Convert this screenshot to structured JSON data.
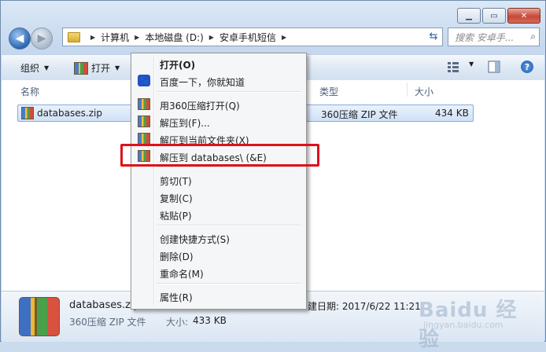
{
  "window": {
    "caption_buttons": [
      "minimize",
      "maximize",
      "close"
    ]
  },
  "address_bar": {
    "crumbs": [
      "计算机",
      "本地磁盘 (D:)",
      "安卓手机短信"
    ]
  },
  "search": {
    "placeholder": "搜索 安卓手..."
  },
  "toolbar": {
    "organize": "组织",
    "open": "打开"
  },
  "columns": {
    "name": "名称",
    "type": "类型",
    "size": "大小"
  },
  "file": {
    "name": "databases.zip",
    "type": "360压缩 ZIP 文件",
    "size": "434 KB"
  },
  "context_menu": {
    "items": [
      {
        "label": "打开(O)",
        "bold": true
      },
      {
        "label": "百度一下，你就知道",
        "icon": "baidu-paw-icon"
      },
      {
        "label": "用360压缩打开(Q)",
        "icon": "archive-icon"
      },
      {
        "label": "解压到(F)...",
        "icon": "archive-icon"
      },
      {
        "label": "解压到当前文件夹(X)",
        "icon": "archive-icon"
      },
      {
        "label": "解压到 databases\\ (&E)",
        "icon": "archive-icon"
      },
      {
        "label": "剪切(T)"
      },
      {
        "label": "复制(C)"
      },
      {
        "label": "粘贴(P)"
      },
      {
        "label": "创建快捷方式(S)"
      },
      {
        "label": "删除(D)"
      },
      {
        "label": "重命名(M)"
      },
      {
        "label": "属性(R)"
      }
    ]
  },
  "details": {
    "name": "databases.zip",
    "type": "360压缩 ZIP 文件",
    "size_label": "大小:",
    "size_value": "433 KB",
    "created": "建日期: 2017/6/22 11:21"
  },
  "watermark": {
    "text": "Baidu 经验",
    "url": "jingyan.baidu.com"
  },
  "colors": {
    "highlight_box": "#e0101a",
    "selection": "#cfe1f7"
  }
}
